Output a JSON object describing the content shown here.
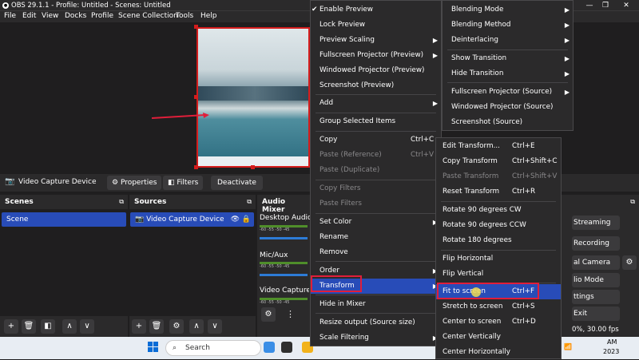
{
  "window": {
    "title": "OBS 29.1.1 - Profile: Untitled - Scenes: Untitled",
    "controls": [
      "—",
      "❐",
      "✕"
    ]
  },
  "menubar": [
    "File",
    "Edit",
    "View",
    "Docks",
    "Profile",
    "Scene Collection",
    "Tools",
    "Help"
  ],
  "context_bar": {
    "source": "Video Capture Device",
    "buttons": [
      "Properties",
      "Filters",
      "Deactivate"
    ]
  },
  "scenes": {
    "title": "Scenes",
    "items": [
      "Scene"
    ]
  },
  "sources": {
    "title": "Sources",
    "items": [
      "Video Capture Device"
    ]
  },
  "audio_mixer": {
    "title": "Audio Mixer",
    "channels": [
      "Desktop Audio",
      "Mic/Aux",
      "Video Capture D"
    ],
    "ticks": "-60  -55  -50  -45"
  },
  "controls": {
    "items": [
      "Streaming",
      "Recording",
      "al Camera",
      "lio Mode",
      "ttings",
      "Exit"
    ],
    "status": "0%, 30.00 fps"
  },
  "taskbar": {
    "search_placeholder": "Search",
    "time": "AM",
    "year": "2023"
  },
  "menu1": {
    "items": [
      {
        "label": "Enable Preview",
        "checked": true
      },
      {
        "label": "Lock Preview"
      },
      {
        "label": "Preview Scaling",
        "submenu": true
      },
      {
        "label": "Fullscreen Projector (Preview)",
        "submenu": true
      },
      {
        "label": "Windowed Projector (Preview)"
      },
      {
        "label": "Screenshot (Preview)"
      },
      {
        "label": "Add",
        "submenu": true
      },
      {
        "label": "Group Selected Items"
      },
      {
        "label": "Copy",
        "shortcut": "Ctrl+C"
      },
      {
        "label": "Paste (Reference)",
        "shortcut": "Ctrl+V",
        "disabled": true
      },
      {
        "label": "Paste (Duplicate)",
        "disabled": true
      },
      {
        "label": "Copy Filters",
        "disabled": true
      },
      {
        "label": "Paste Filters",
        "disabled": true
      },
      {
        "label": "Set Color",
        "submenu": true
      },
      {
        "label": "Rename"
      },
      {
        "label": "Remove"
      },
      {
        "label": "Order",
        "submenu": true
      },
      {
        "label": "Transform",
        "submenu": true,
        "highlighted": true
      },
      {
        "label": "Hide in Mixer"
      },
      {
        "label": "Resize output (Source size)"
      },
      {
        "label": "Scale Filtering",
        "submenu": true
      }
    ]
  },
  "menu2": {
    "items": [
      {
        "label": "Blending Mode",
        "submenu": true
      },
      {
        "label": "Blending Method",
        "submenu": true
      },
      {
        "label": "Deinterlacing",
        "submenu": true
      },
      {
        "label": "Show Transition",
        "submenu": true
      },
      {
        "label": "Hide Transition",
        "submenu": true
      },
      {
        "label": "Fullscreen Projector (Source)",
        "submenu": true
      },
      {
        "label": "Windowed Projector (Source)"
      },
      {
        "label": "Screenshot (Source)"
      }
    ]
  },
  "menu3": {
    "items": [
      {
        "label": "Edit Transform...",
        "shortcut": "Ctrl+E"
      },
      {
        "label": "Copy Transform",
        "shortcut": "Ctrl+Shift+C"
      },
      {
        "label": "Paste Transform",
        "shortcut": "Ctrl+Shift+V",
        "disabled": true
      },
      {
        "label": "Reset Transform",
        "shortcut": "Ctrl+R"
      },
      {
        "label": "Rotate 90 degrees CW"
      },
      {
        "label": "Rotate 90 degrees CCW"
      },
      {
        "label": "Rotate 180 degrees"
      },
      {
        "label": "Flip Horizontal"
      },
      {
        "label": "Flip Vertical"
      },
      {
        "label": "Fit to screen",
        "shortcut": "Ctrl+F",
        "highlighted": true
      },
      {
        "label": "Stretch to screen",
        "shortcut": "Ctrl+S"
      },
      {
        "label": "Center to screen",
        "shortcut": "Ctrl+D"
      },
      {
        "label": "Center Vertically"
      },
      {
        "label": "Center Horizontally"
      }
    ]
  },
  "colors": {
    "accent": "#284cb8",
    "highlight_border": "#e01e3a",
    "background": "#1f1e1f",
    "panel": "#2b2a2b"
  }
}
